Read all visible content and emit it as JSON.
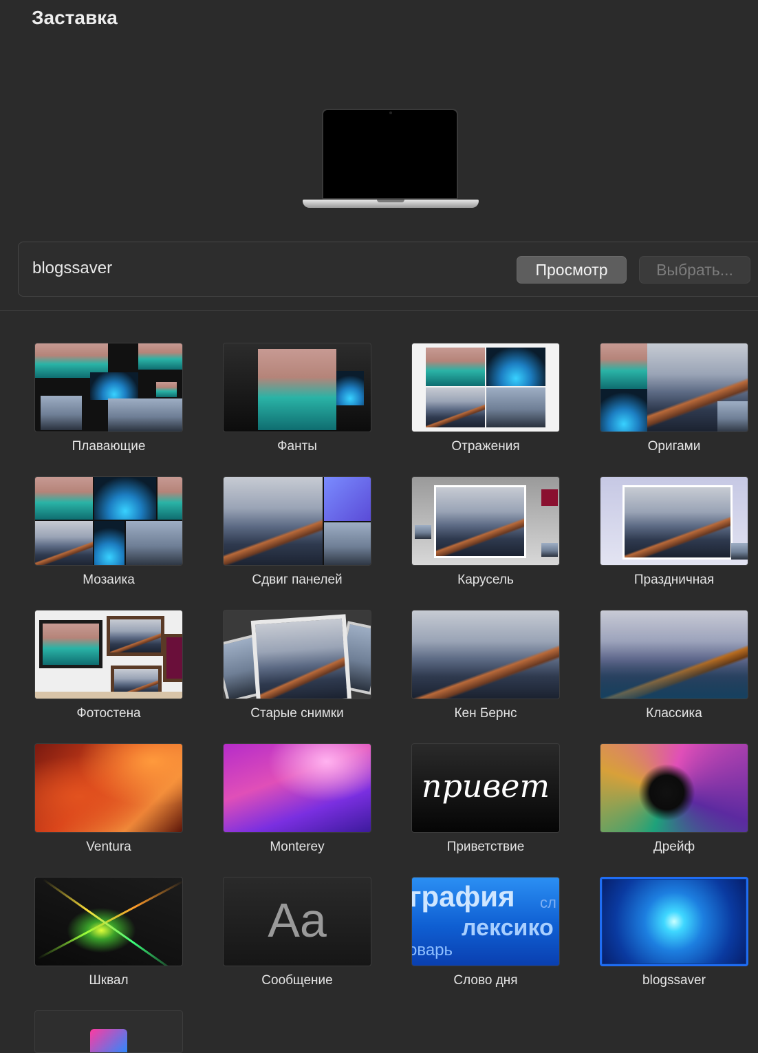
{
  "header": {
    "title": "Заставка"
  },
  "current": {
    "name": "blogssaver",
    "preview_label": "Просмотр",
    "choose_label": "Выбрать..."
  },
  "savers": [
    {
      "label": "Плавающие"
    },
    {
      "label": "Фанты"
    },
    {
      "label": "Отражения"
    },
    {
      "label": "Оригами"
    },
    {
      "label": "Мозаика"
    },
    {
      "label": "Сдвиг панелей"
    },
    {
      "label": "Карусель"
    },
    {
      "label": "Праздничная"
    },
    {
      "label": "Фотостена"
    },
    {
      "label": "Старые снимки"
    },
    {
      "label": "Кен Бернс"
    },
    {
      "label": "Классика"
    },
    {
      "label": "Ventura"
    },
    {
      "label": "Monterey"
    },
    {
      "label": "Приветствие",
      "thumb_text": "привет"
    },
    {
      "label": "Дрейф"
    },
    {
      "label": "Шквал"
    },
    {
      "label": "Сообщение",
      "thumb_text": "Aa"
    },
    {
      "label": "Слово дня",
      "thumb_words": [
        "графия",
        "лексико",
        "оварь",
        "сл"
      ]
    },
    {
      "label": "blogssaver",
      "selected": true
    }
  ],
  "accent_color": "#1f6df4"
}
